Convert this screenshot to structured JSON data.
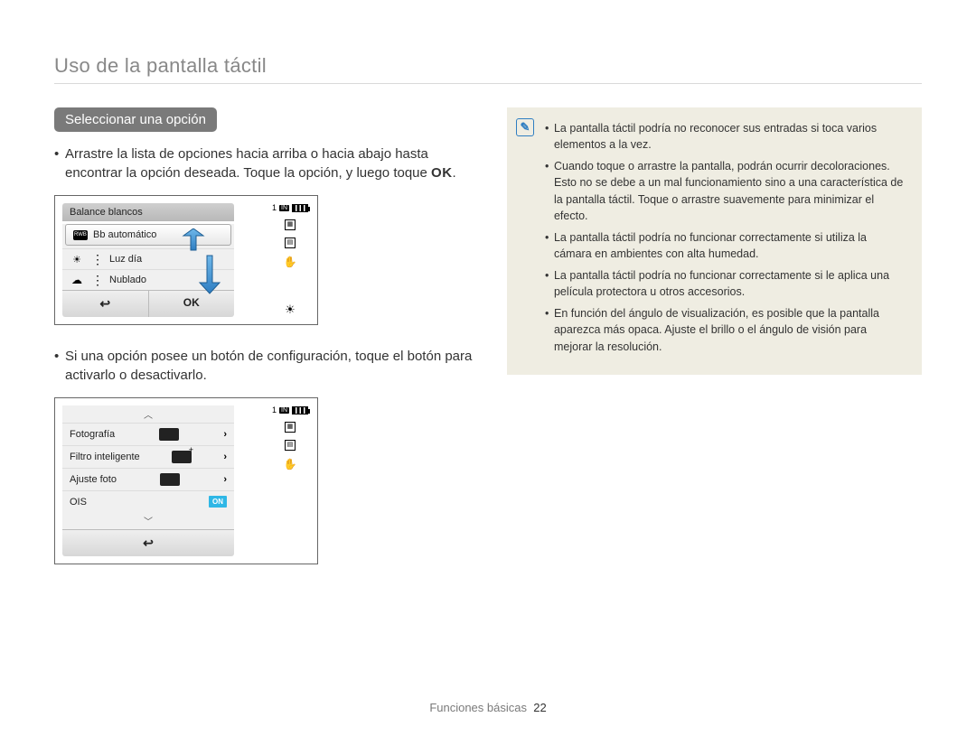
{
  "page": {
    "title": "Uso de la pantalla táctil",
    "footer_section": "Funciones básicas",
    "footer_page": "22"
  },
  "section": {
    "heading": "Seleccionar una opción",
    "para1_a": "Arrastre la lista de opciones hacia arriba o hacia abajo hasta encontrar la opción deseada. Toque la opción, y luego toque ",
    "ok_label": "OK",
    "para1_b": ".",
    "para2": "Si una opción posee un botón de configuración, toque el botón para activarlo o desactivarlo."
  },
  "device1": {
    "header": "Balance blancos",
    "opt1": "Bb automático",
    "opt2": "Luz día",
    "opt3": "Nublado",
    "ok": "OK",
    "counter": "1"
  },
  "device2": {
    "row1": "Fotografía",
    "row2": "Filtro inteligente",
    "row3": "Ajuste foto",
    "row4": "OIS",
    "toggle": "ON",
    "counter": "1"
  },
  "notes": {
    "n1": "La pantalla táctil podría no reconocer sus entradas si toca varios elementos a la vez.",
    "n2": "Cuando toque o arrastre la pantalla, podrán ocurrir decoloraciones. Esto no se debe a un mal funcionamiento sino a una característica de la pantalla táctil. Toque o arrastre suavemente para minimizar el efecto.",
    "n3": "La pantalla táctil podría no funcionar correctamente si utiliza la cámara en ambientes con alta humedad.",
    "n4": "La pantalla táctil podría no funcionar correctamente si le aplica una película protectora u otros accesorios.",
    "n5": "En función del ángulo de visualización, es posible que la pantalla aparezca más opaca. Ajuste el brillo o el ángulo de visión para mejorar la resolución."
  }
}
